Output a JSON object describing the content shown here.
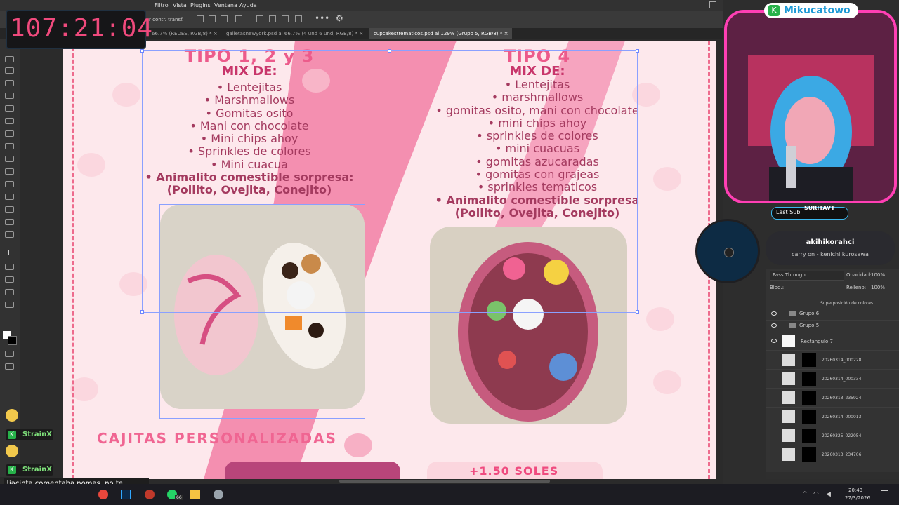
{
  "timer": "107:21:04",
  "menu": [
    "Filtro",
    "Vista",
    "Plugins",
    "Ventana",
    "Ayuda"
  ],
  "options_bar": {
    "label": "r contr. transf."
  },
  "tabs": [
    {
      "label": "66.7% (REDES, RGB/8) *",
      "active": false
    },
    {
      "label": "galletasnewyork.psd al 66.7% (4 und  6 und, RGB/8) *",
      "active": false
    },
    {
      "label": "cupcakestrematicos.psd al 129% (Grupo 5, RGB/8) *",
      "active": true
    }
  ],
  "canvas": {
    "left": {
      "title": "TIPO 1, 2 y 3",
      "subtitle": "MIX DE:",
      "items": [
        "Lentejitas",
        "Marshmallows",
        "Gomitas osito",
        "Mani con chocolate",
        "Mini chips ahoy",
        "Sprinkles de colores",
        "Mini cuacua"
      ],
      "bold_item": "Animalito comestible sorpresa:",
      "bold_item_2": "(Pollito, Ovejita, Conejito)"
    },
    "right": {
      "title": "TIPO 4",
      "subtitle": "MIX DE:",
      "items": [
        "Lentejitas",
        "marshmallows",
        "gomitas osito, mani con chocolate",
        "mini chips ahoy",
        "sprinkles de colores",
        "mini cuacuas",
        "gomitas azucaradas",
        "gomitas con grajeas",
        "sprinkles tematicos"
      ],
      "bold_item": "Animalito comestible sorpresa",
      "bold_item_2": "(Pollito, Ovejita, Conejito)"
    },
    "section_title": "CAJITAS PERSONALIZADAS",
    "price_badge": "+1.50 SOLES",
    "colors": {
      "bg": "#fde8ec",
      "pink": "#f48fb0",
      "accent": "#ec5b8b",
      "text": "#a43a5f"
    }
  },
  "stream": {
    "brand": "Mikucatowo",
    "last_sub_label": "Last Sub",
    "last_sub_name": "SURITAVT",
    "now_playing_title": "akihikorahci",
    "now_playing_subtitle": "carry on - kenichi kurosawa"
  },
  "layers_panel": {
    "blend_mode": "Pass Through",
    "opacity_label": "Opacidad:",
    "opacity_value": "100%",
    "lock_label": "Bloq.:",
    "fill_label": "Relleno:",
    "fill_value": "100%",
    "effect_label": "Superposición de colores",
    "layers": [
      {
        "name": "Grupo 6",
        "visible": true,
        "type": "group"
      },
      {
        "name": "Grupo 5",
        "visible": true,
        "type": "group"
      },
      {
        "name": "Rectángulo 7",
        "visible": true,
        "type": "shape"
      },
      {
        "name": "20260314_000228",
        "visible": false,
        "type": "image"
      },
      {
        "name": "20260314_000334",
        "visible": false,
        "type": "image"
      },
      {
        "name": "20260313_235924",
        "visible": false,
        "type": "image"
      },
      {
        "name": "20260314_000013",
        "visible": false,
        "type": "image"
      },
      {
        "name": "20260325_022054",
        "visible": false,
        "type": "image"
      },
      {
        "name": "20260313_234706",
        "visible": false,
        "type": "image"
      }
    ]
  },
  "chat": [
    {
      "user": "StrainX",
      "message": ""
    },
    {
      "user": "StrainX",
      "message": "!jacinta comentaba nomas, no te estaba preguntando"
    }
  ],
  "taskbar": {
    "badge": "66",
    "time": "20:43",
    "date": "27/3/2026"
  }
}
